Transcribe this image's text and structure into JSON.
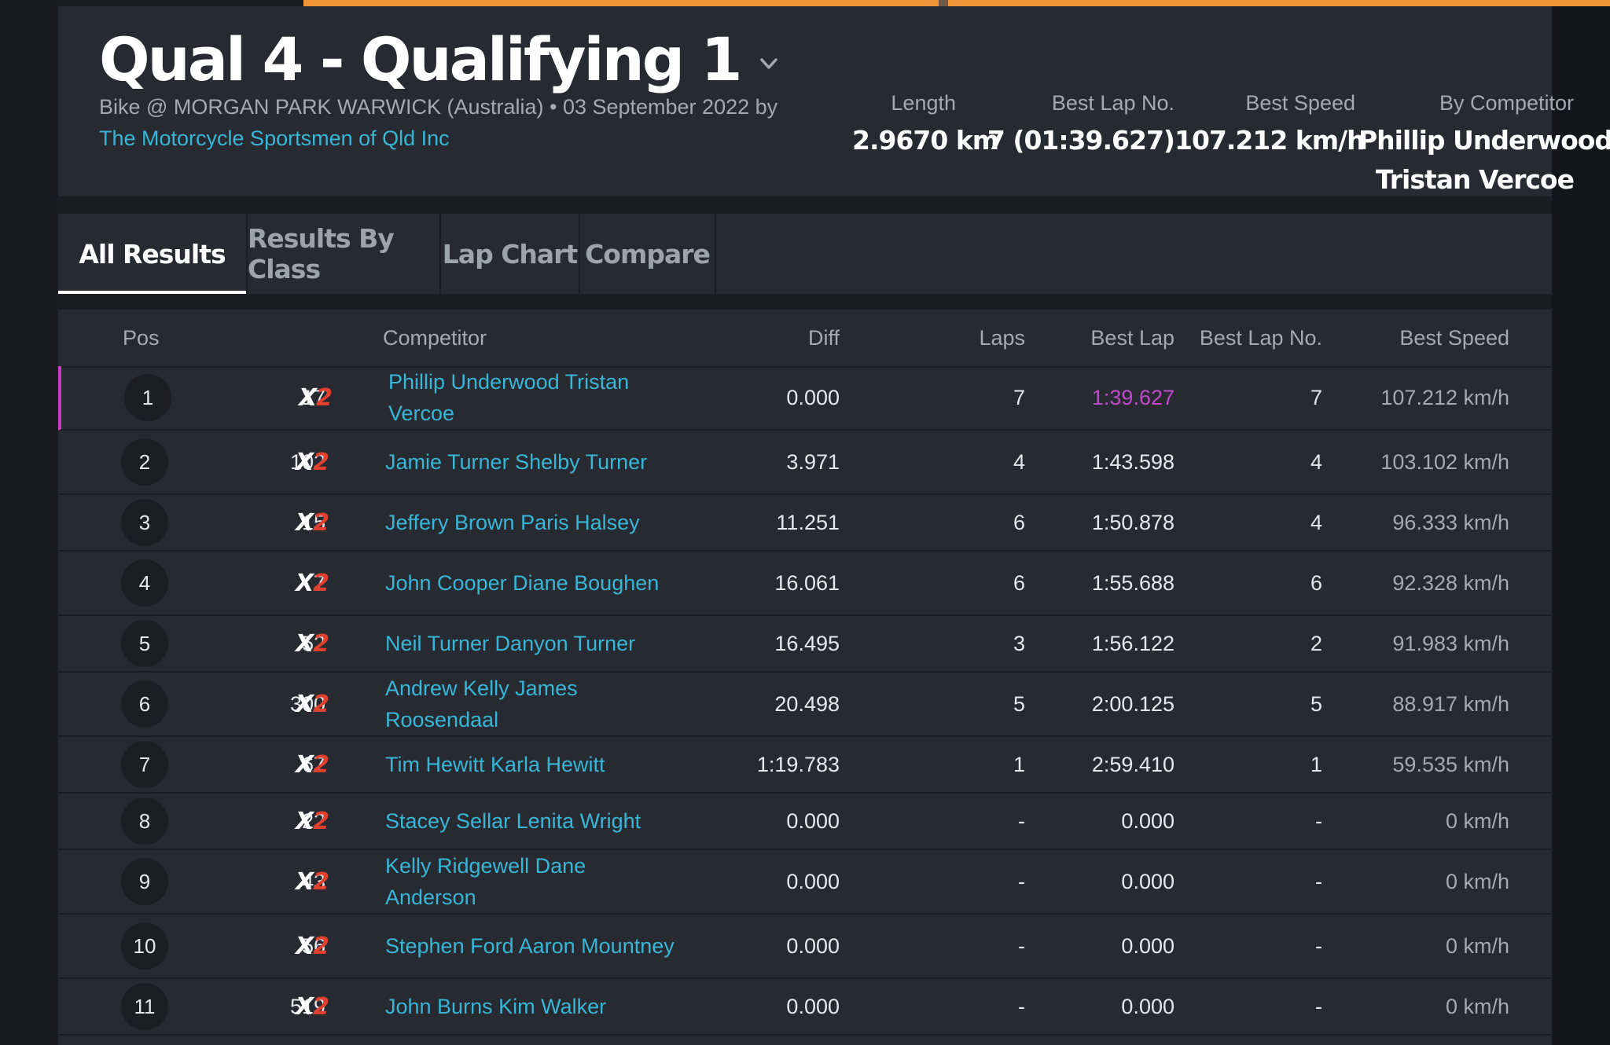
{
  "session": {
    "title": "Qual 4 - Qualifying 1",
    "meta_text": "Bike @ MORGAN PARK WARWICK (Australia) • 03 September 2022 by",
    "organiser": "The Motorcycle Sportsmen of Qld Inc"
  },
  "stats": {
    "length_label": "Length",
    "length_value": "2.9670 km",
    "best_lap_no_label": "Best Lap No.",
    "best_lap_no_value": "7 (01:39.627)",
    "best_speed_label": "Best Speed",
    "best_speed_value": "107.212 km/h",
    "by_competitor_label": "By Competitor",
    "by_competitor_line1": "Phillip Underwood",
    "by_competitor_line2": "Tristan Vercoe"
  },
  "tabs": [
    {
      "label": "All Results",
      "active": true
    },
    {
      "label": "Results By Class",
      "active": false
    },
    {
      "label": "Lap Chart",
      "active": false
    },
    {
      "label": "Compare",
      "active": false
    }
  ],
  "table": {
    "headers": {
      "pos": "Pos",
      "competitor": "Competitor",
      "diff": "Diff",
      "laps": "Laps",
      "best_lap": "Best Lap",
      "best_lap_no": "Best Lap No.",
      "best_speed": "Best Speed"
    },
    "class_logo": {
      "x": "X",
      "two": "2"
    },
    "rows": [
      {
        "pos": "1",
        "number": "17",
        "competitor": "Phillip Underwood Tristan Vercoe",
        "diff": "0.000",
        "laps": "7",
        "best_lap": "1:39.627",
        "best_lap_no": "7",
        "best_speed": "107.212 km/h"
      },
      {
        "pos": "2",
        "number": "102",
        "competitor": "Jamie Turner Shelby Turner",
        "diff": "3.971",
        "laps": "4",
        "best_lap": "1:43.598",
        "best_lap_no": "4",
        "best_speed": "103.102 km/h"
      },
      {
        "pos": "3",
        "number": "15",
        "competitor": "Jeffery Brown Paris Halsey",
        "diff": "11.251",
        "laps": "6",
        "best_lap": "1:50.878",
        "best_lap_no": "4",
        "best_speed": "96.333 km/h"
      },
      {
        "pos": "4",
        "number": "7",
        "competitor": "John Cooper Diane Boughen",
        "diff": "16.061",
        "laps": "6",
        "best_lap": "1:55.688",
        "best_lap_no": "6",
        "best_speed": "92.328 km/h"
      },
      {
        "pos": "5",
        "number": "52",
        "competitor": "Neil Turner Danyon Turner",
        "diff": "16.495",
        "laps": "3",
        "best_lap": "1:56.122",
        "best_lap_no": "2",
        "best_speed": "91.983 km/h"
      },
      {
        "pos": "6",
        "number": "300",
        "competitor": "Andrew Kelly James Roosendaal",
        "diff": "20.498",
        "laps": "5",
        "best_lap": "2:00.125",
        "best_lap_no": "5",
        "best_speed": "88.917 km/h"
      },
      {
        "pos": "7",
        "number": "67",
        "competitor": "Tim Hewitt Karla Hewitt",
        "diff": "1:19.783",
        "laps": "1",
        "best_lap": "2:59.410",
        "best_lap_no": "1",
        "best_speed": "59.535 km/h"
      },
      {
        "pos": "8",
        "number": "22",
        "competitor": "Stacey Sellar Lenita Wright",
        "diff": "0.000",
        "laps": "-",
        "best_lap": "0.000",
        "best_lap_no": "-",
        "best_speed": "0 km/h"
      },
      {
        "pos": "9",
        "number": "43",
        "competitor": "Kelly Ridgewell Dane Anderson",
        "diff": "0.000",
        "laps": "-",
        "best_lap": "0.000",
        "best_lap_no": "-",
        "best_speed": "0 km/h"
      },
      {
        "pos": "10",
        "number": "56",
        "competitor": "Stephen Ford Aaron Mountney",
        "diff": "0.000",
        "laps": "-",
        "best_lap": "0.000",
        "best_lap_no": "-",
        "best_speed": "0 km/h"
      },
      {
        "pos": "11",
        "number": "519",
        "competitor": "John Burns Kim Walker",
        "diff": "0.000",
        "laps": "-",
        "best_lap": "0.000",
        "best_lap_no": "-",
        "best_speed": "0 km/h"
      }
    ]
  },
  "colors": {
    "accent_orange": "#f0943a",
    "link_blue": "#38b6d8",
    "fastest_lap_purple": "#c04acb",
    "class_red": "#e2402e"
  }
}
